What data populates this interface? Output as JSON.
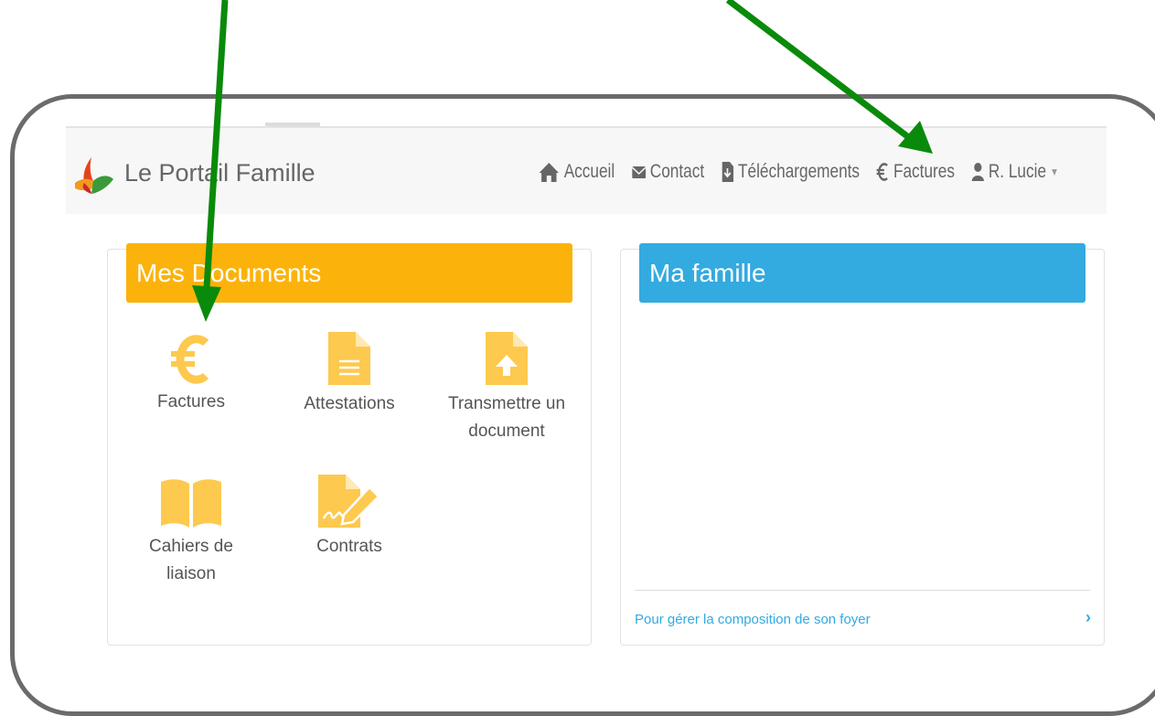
{
  "navbar": {
    "brand": "Le Portail Famille",
    "items": [
      {
        "label": "Accueil",
        "icon": "home-icon"
      },
      {
        "label": "Contact",
        "icon": "envelope-icon"
      },
      {
        "label": "Téléchargements",
        "icon": "download-file-icon"
      },
      {
        "label": "Factures",
        "icon": "euro-icon"
      },
      {
        "label": "R. Lucie",
        "icon": "user-icon"
      }
    ]
  },
  "documents": {
    "title": "Mes Documents",
    "tiles": [
      {
        "label": "Factures",
        "icon": "euro-icon"
      },
      {
        "label": "Attestations",
        "icon": "document-icon"
      },
      {
        "label": "Transmettre un document",
        "icon": "upload-file-icon"
      },
      {
        "label": "Cahiers de liaison",
        "icon": "book-icon"
      },
      {
        "label": "Contrats",
        "icon": "signature-icon"
      }
    ]
  },
  "family": {
    "title": "Ma famille",
    "link": "Pour gérer la composition de son foyer"
  },
  "colors": {
    "docs_accent": "#fbb30c",
    "icon_color": "#fdc94e",
    "family_accent": "#33aae0",
    "annotation_arrow": "#0a8a0a"
  }
}
